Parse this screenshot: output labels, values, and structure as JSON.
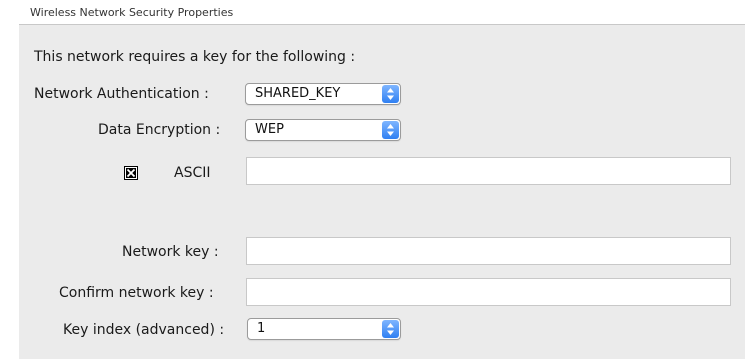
{
  "window": {
    "title": "Wireless Network Security Properties"
  },
  "form": {
    "heading": "This network requires a key for the following :",
    "network_authentication": {
      "label": "Network Authentication :",
      "value": "SHARED_KEY"
    },
    "data_encryption": {
      "label": "Data Encryption :",
      "value": "WEP"
    },
    "ascii": {
      "label": "ASCII",
      "checked": true,
      "value": ""
    },
    "network_key": {
      "label": "Network key :",
      "value": ""
    },
    "confirm_network_key": {
      "label": "Confirm network key :",
      "value": ""
    },
    "key_index": {
      "label": "Key index (advanced) :",
      "value": "1"
    }
  },
  "icons": {
    "popup_stepper": "updown-arrows-icon",
    "checkbox": "checkbox-checked-icon"
  },
  "colors": {
    "panel_bg": "#ebebeb",
    "stepper_blue": "#2f7ff2",
    "field_bg": "#ffffff"
  }
}
